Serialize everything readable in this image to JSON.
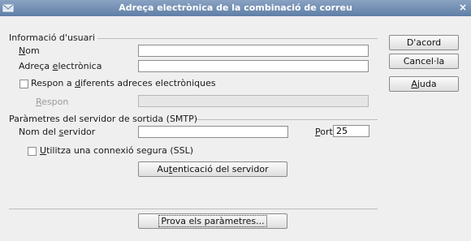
{
  "window": {
    "title": "Adreça electrònica de la combinació de correu",
    "close": "×"
  },
  "user_info": {
    "heading": "Informació d'usuari",
    "name_label": "Nom",
    "email_label": "Adreça electrònica",
    "reply_checkbox": "Respon a diferents adreces electròniques",
    "reply_label": "Respon",
    "name_value": "",
    "email_value": "",
    "reply_value": ""
  },
  "smtp": {
    "heading": "Paràmetres del servidor de sortida (SMTP)",
    "server_label": "Nom del servidor",
    "server_value": "",
    "port_label": "Port",
    "port_value": "25",
    "ssl_checkbox": "Utilitza una connexió segura (SSL)",
    "auth_button": "Autenticació del servidor"
  },
  "test_button": "Prova els paràmetres...",
  "buttons": {
    "ok": "D'acord",
    "cancel": "Cancel·la",
    "help": "Ajuda"
  },
  "colors": {
    "titlebar": "#6f8cb3",
    "background": "#efefef"
  }
}
